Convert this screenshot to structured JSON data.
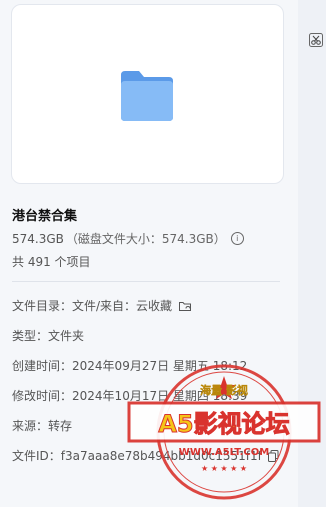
{
  "item": {
    "name": "港台禁合集",
    "size": "574.3GB",
    "disk_size_text": "（磁盘文件大小：574.3GB）",
    "count_text": "共 491 个项目"
  },
  "details": [
    {
      "label": "文件目录：",
      "value": "文件/来自：云收藏"
    },
    {
      "label": "类型：",
      "value": "文件夹"
    },
    {
      "label": "创建时间：",
      "value": "2024年09月27日 星期五 18:12"
    },
    {
      "label": "修改时间：",
      "value": "2024年10月17日 星期四 18:39"
    },
    {
      "label": "来源：",
      "value": "转存"
    },
    {
      "label": "文件ID：",
      "value": "f3a7aaa8e78b494bb1d0c1551f1f"
    }
  ],
  "watermark": {
    "top_text": "海量 影视",
    "main_text": "A5影视论坛",
    "url_text": "WWW.A5LT.COM"
  },
  "colors": {
    "folder_back": "#5b9ae8",
    "folder_front": "#86bbf6",
    "seal_red": "#d9332e",
    "seal_gold": "#f5c518"
  }
}
